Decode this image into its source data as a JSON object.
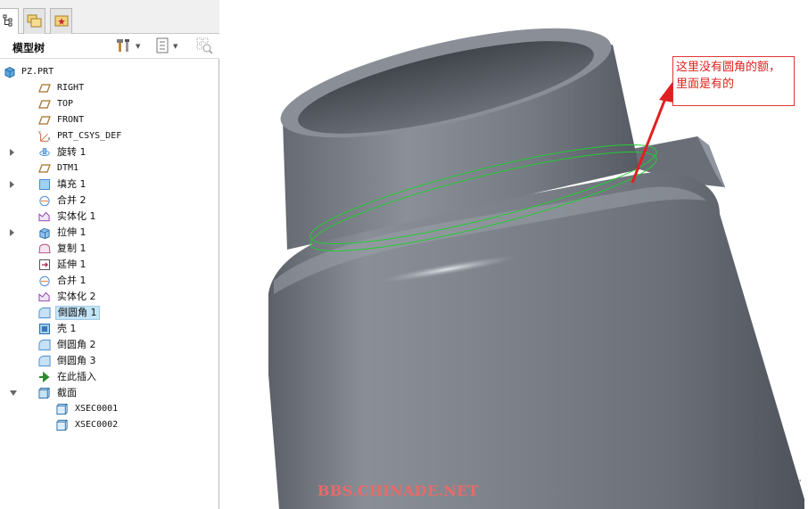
{
  "model_tree": {
    "title": "模型树",
    "tabs": [
      {
        "icon": "model-tree-tab-icon"
      },
      {
        "icon": "folder-browser-icon"
      },
      {
        "icon": "favorites-icon"
      }
    ],
    "header_icons": [
      "tools-icon",
      "settings-icon",
      "filter-icon"
    ],
    "nodes": [
      {
        "label": "PZ.PRT",
        "icon": "part-icon",
        "level": 0,
        "expander": "none",
        "mono": true
      },
      {
        "label": "RIGHT",
        "icon": "datum-plane-icon",
        "level": 1,
        "expander": "none",
        "mono": true
      },
      {
        "label": "TOP",
        "icon": "datum-plane-icon",
        "level": 1,
        "expander": "none",
        "mono": true
      },
      {
        "label": "FRONT",
        "icon": "datum-plane-icon",
        "level": 1,
        "expander": "none",
        "mono": true
      },
      {
        "label": "PRT_CSYS_DEF",
        "icon": "coordinate-system-icon",
        "level": 1,
        "expander": "none",
        "mono": true
      },
      {
        "label": "旋转 1",
        "icon": "revolve-icon",
        "level": 1,
        "expander": "collapsed",
        "mono": false
      },
      {
        "label": "DTM1",
        "icon": "datum-plane-icon",
        "level": 1,
        "expander": "none",
        "mono": true
      },
      {
        "label": "填充 1",
        "icon": "fill-icon",
        "level": 1,
        "expander": "collapsed",
        "mono": false
      },
      {
        "label": "合并 2",
        "icon": "merge-icon",
        "level": 1,
        "expander": "none",
        "mono": false
      },
      {
        "label": "实体化 1",
        "icon": "solidify-icon",
        "level": 1,
        "expander": "none",
        "mono": false
      },
      {
        "label": "拉伸 1",
        "icon": "extrude-icon",
        "level": 1,
        "expander": "collapsed",
        "mono": false
      },
      {
        "label": "复制 1",
        "icon": "copy-icon",
        "level": 1,
        "expander": "none",
        "mono": false
      },
      {
        "label": "延伸 1",
        "icon": "extend-icon",
        "level": 1,
        "expander": "none",
        "mono": false
      },
      {
        "label": "合并 1",
        "icon": "merge-icon",
        "level": 1,
        "expander": "none",
        "mono": false
      },
      {
        "label": "实体化 2",
        "icon": "solidify-icon",
        "level": 1,
        "expander": "none",
        "mono": false
      },
      {
        "label": "倒圆角 1",
        "icon": "round-icon",
        "level": 1,
        "expander": "none",
        "mono": false,
        "selected": true
      },
      {
        "label": "壳 1",
        "icon": "shell-icon",
        "level": 1,
        "expander": "none",
        "mono": false
      },
      {
        "label": "倒圆角 2",
        "icon": "round-icon",
        "level": 1,
        "expander": "none",
        "mono": false
      },
      {
        "label": "倒圆角 3",
        "icon": "round-icon",
        "level": 1,
        "expander": "none",
        "mono": false
      },
      {
        "label": "在此插入",
        "icon": "insert-here-arrow-icon",
        "level": 1,
        "expander": "none",
        "mono": false
      },
      {
        "label": "截面",
        "icon": "section-icon",
        "level": 1,
        "expander": "expanded",
        "mono": false
      },
      {
        "label": "XSEC0001",
        "icon": "xsection-icon",
        "level": 2,
        "expander": "none",
        "mono": true
      },
      {
        "label": "XSEC0002",
        "icon": "xsection-icon",
        "level": 2,
        "expander": "none",
        "mono": true
      }
    ]
  },
  "viewport": {
    "annotation_line1": "这里没有圆角的额，",
    "annotation_line2": "里面是有的",
    "watermark": "BBS.CHINADE.NET",
    "corner_mark": "'",
    "colors": {
      "annotation": "#e02020",
      "highlight_edge": "#22cc33",
      "part_body": "#7c8189",
      "selection": "#c4e4f7"
    }
  }
}
